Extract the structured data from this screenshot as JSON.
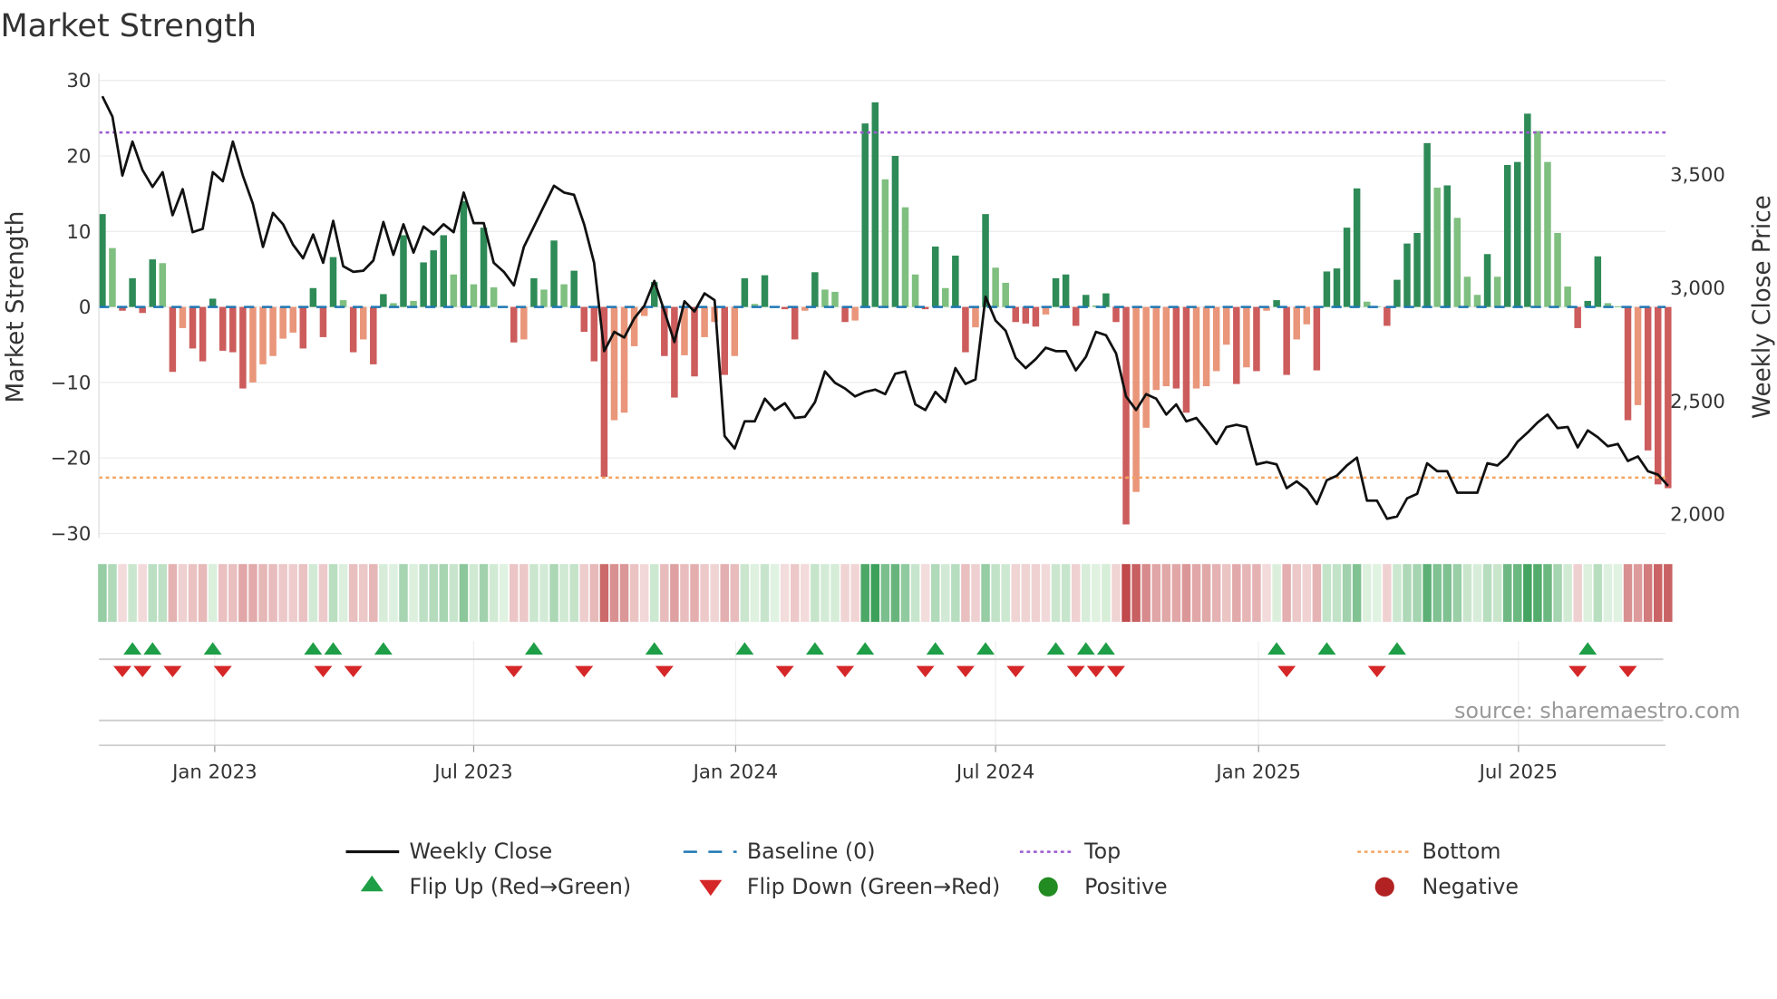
{
  "chart_data": {
    "type": "bar",
    "title": "Market Strength",
    "ylabel": "Market Strength",
    "y2label": "Weekly Close Price",
    "ylim": [
      -30,
      30
    ],
    "y2lim": [
      1900,
      4000
    ],
    "yticks": [
      "30",
      "20",
      "10",
      "0",
      "−10",
      "−20",
      "−30"
    ],
    "ytick_values": [
      30,
      20,
      10,
      0,
      -10,
      -20,
      -30
    ],
    "y2ticks": [
      "3,500",
      "3,000",
      "2,500",
      "2,000"
    ],
    "y2tick_values": [
      3500,
      3000,
      2500,
      2000
    ],
    "xticks": [
      "Jan 2023",
      "Jul 2023",
      "Jan 2024",
      "Jul 2024",
      "Jan 2025",
      "Jul 2025"
    ],
    "xtick_week_index": [
      11.2,
      37.0,
      63.1,
      89.0,
      115.2,
      141.1
    ],
    "frequency": "weekly",
    "top_level": 23.1,
    "bottom_level": -22.6,
    "strength": [
      12.3,
      7.8,
      -0.5,
      3.8,
      -0.8,
      6.3,
      5.8,
      -8.6,
      -2.8,
      -5.5,
      -7.2,
      1.1,
      -5.8,
      -6.0,
      -10.8,
      -10.0,
      -7.6,
      -6.5,
      -4.2,
      -3.4,
      -5.5,
      2.5,
      -4.0,
      6.6,
      0.9,
      -6.0,
      -4.3,
      -7.6,
      1.7,
      0.5,
      9.5,
      0.8,
      5.9,
      7.5,
      9.5,
      4.3,
      14.0,
      3.0,
      10.5,
      2.6,
      0.1,
      -4.7,
      -4.3,
      3.8,
      2.3,
      8.8,
      3.0,
      4.8,
      -3.3,
      -7.2,
      -22.5,
      -15.0,
      -14.0,
      -5.2,
      -1.2,
      3.3,
      -6.5,
      -12.0,
      -6.4,
      -9.2,
      -4.0,
      -2.0,
      -9.0,
      -6.5,
      3.8,
      0.4,
      4.2,
      0.1,
      -0.3,
      -4.3,
      -0.5,
      4.6,
      2.3,
      2.0,
      -2.0,
      -1.8,
      24.3,
      27.1,
      16.9,
      20.0,
      13.2,
      4.3,
      -0.3,
      8.0,
      2.5,
      6.8,
      -6.0,
      -2.7,
      12.3,
      5.2,
      3.2,
      -2.0,
      -2.2,
      -2.6,
      -1.0,
      3.8,
      4.3,
      -2.5,
      1.6,
      0.2,
      1.8,
      -2.0,
      -28.8,
      -24.5,
      -16.0,
      -11.0,
      -10.5,
      -10.8,
      -14.0,
      -10.8,
      -10.5,
      -8.5,
      -5.0,
      -10.2,
      -8.0,
      -8.5,
      -0.5,
      0.9,
      -9.0,
      -4.3,
      -2.3,
      -8.4,
      4.7,
      5.1,
      10.5,
      15.7,
      0.7,
      0.1,
      -2.5,
      3.6,
      8.4,
      9.8,
      21.7,
      15.8,
      16.1,
      11.8,
      4.0,
      1.6,
      7.0,
      4.0,
      18.8,
      19.2,
      25.6,
      23.3,
      19.2,
      9.8,
      2.7,
      -2.8,
      0.8,
      6.7,
      0.5,
      0.1,
      -15.0,
      -13.0,
      -19.0,
      -23.5,
      -24.0
    ],
    "weekly_close": [
      3845,
      3755,
      3495,
      3645,
      3520,
      3445,
      3510,
      3320,
      3435,
      3245,
      3260,
      3510,
      3470,
      3645,
      3495,
      3370,
      3180,
      3330,
      3280,
      3190,
      3130,
      3235,
      3110,
      3295,
      3095,
      3070,
      3075,
      3120,
      3290,
      3145,
      3280,
      3155,
      3270,
      3235,
      3280,
      3245,
      3420,
      3285,
      3285,
      3110,
      3070,
      3010,
      3180,
      3270,
      3360,
      3450,
      3420,
      3410,
      3280,
      3110,
      2720,
      2805,
      2780,
      2865,
      2920,
      3030,
      2895,
      2760,
      2940,
      2895,
      2975,
      2945,
      2345,
      2290,
      2410,
      2410,
      2510,
      2460,
      2490,
      2425,
      2430,
      2495,
      2630,
      2580,
      2555,
      2520,
      2540,
      2550,
      2530,
      2620,
      2630,
      2485,
      2460,
      2540,
      2495,
      2645,
      2575,
      2595,
      2960,
      2855,
      2810,
      2690,
      2645,
      2685,
      2735,
      2720,
      2720,
      2635,
      2695,
      2805,
      2790,
      2710,
      2520,
      2460,
      2530,
      2510,
      2440,
      2485,
      2410,
      2425,
      2370,
      2310,
      2385,
      2395,
      2385,
      2220,
      2230,
      2220,
      2115,
      2145,
      2110,
      2045,
      2150,
      2170,
      2215,
      2250,
      2060,
      2060,
      1980,
      1990,
      2070,
      2090,
      2225,
      2190,
      2190,
      2095,
      2095,
      2095,
      2225,
      2215,
      2255,
      2320,
      2360,
      2405,
      2440,
      2380,
      2385,
      2295,
      2370,
      2340,
      2300,
      2310,
      2235,
      2255,
      2190,
      2175,
      2125
    ],
    "flip_up_weeks": [
      3,
      5,
      11,
      21,
      23,
      28,
      43,
      55,
      64,
      71,
      76,
      83,
      88,
      95,
      98,
      100,
      117,
      122,
      129,
      148
    ],
    "flip_down_weeks": [
      2,
      4,
      7,
      12,
      22,
      25,
      41,
      48,
      56,
      68,
      74,
      82,
      86,
      91,
      97,
      99,
      101,
      118,
      127,
      147,
      152
    ],
    "legend": [
      "Weekly Close",
      "Baseline (0)",
      "Top",
      "Bottom",
      "Flip Up (Red→Green)",
      "Flip Down (Green→Red)",
      "Positive",
      "Negative"
    ],
    "legend_placement": "bottom",
    "grid": true
  },
  "source": "source: sharemaestro.com",
  "colors": {
    "strong_green": "#2e8b57",
    "weak_green": "#7fbf7f",
    "strong_red": "#cd5c5c",
    "weak_red": "#e9967a",
    "price_line": "#111111",
    "baseline": "#1f77b4",
    "top": "#9b59d0",
    "bottom": "#f4a460",
    "flip_up": "#1e9e46",
    "flip_down": "#d62728",
    "positive": "#228b22",
    "negative": "#b22222"
  }
}
